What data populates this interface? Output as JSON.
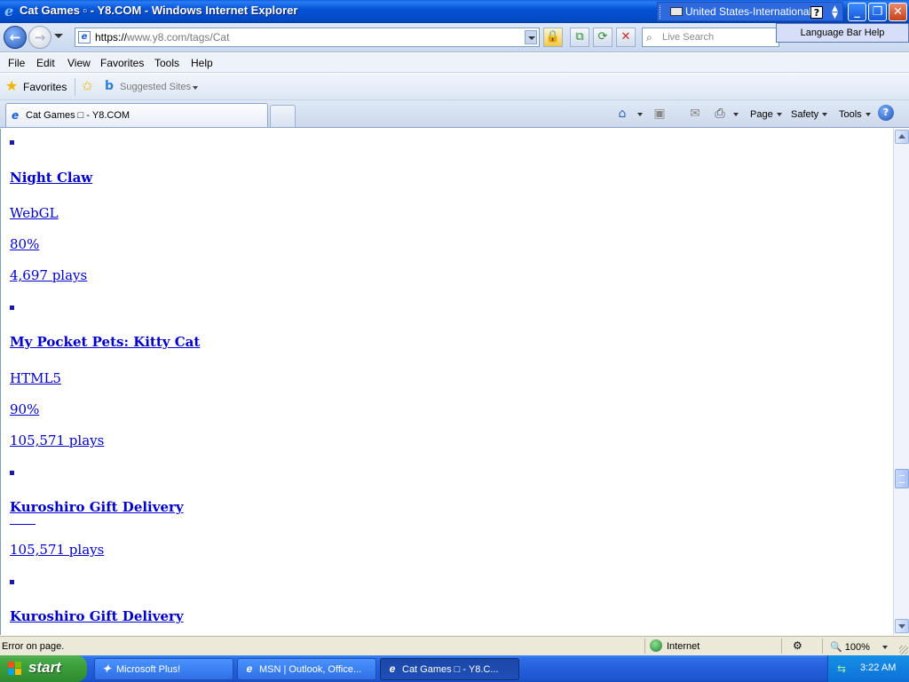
{
  "window": {
    "title": "Cat Games ▫ - Y8.COM - Windows Internet Explorer",
    "language_bar": {
      "label": "United States-International",
      "help": "?"
    },
    "tooltip": "Language Bar Help"
  },
  "address": {
    "url_scheme": "https://",
    "url_host": "www.y8.com",
    "url_path": "/tags/Cat",
    "search_placeholder": "Live Search"
  },
  "menu": [
    "File",
    "Edit",
    "View",
    "Favorites",
    "Tools",
    "Help"
  ],
  "favorites_bar": {
    "favorites_label": "Favorites",
    "suggested_label": "Suggested Sites"
  },
  "tab": {
    "label": "Cat Games □ - Y8.COM"
  },
  "command_bar": {
    "page": "Page",
    "safety": "Safety",
    "tools": "Tools"
  },
  "content": {
    "items": [
      {
        "title": "Night Claw",
        "tech": "WebGL",
        "rating": "80%",
        "plays": "4,697 plays"
      },
      {
        "title": "My Pocket Pets: Kitty Cat",
        "tech": "HTML5",
        "rating": "90%",
        "plays": "105,571 plays"
      },
      {
        "title": "Kuroshiro Gift Delivery",
        "plays": "105,571 plays"
      },
      {
        "title": "Kuroshiro Gift Delivery"
      }
    ]
  },
  "status": {
    "text": "Error on page.",
    "zone": "Internet",
    "zoom": "100%"
  },
  "taskbar": {
    "start": "start",
    "tasks": [
      "Microsoft Plus!",
      "MSN | Outlook, Office...",
      "Cat Games □ - Y8.C..."
    ],
    "clock": "3:22 AM"
  }
}
